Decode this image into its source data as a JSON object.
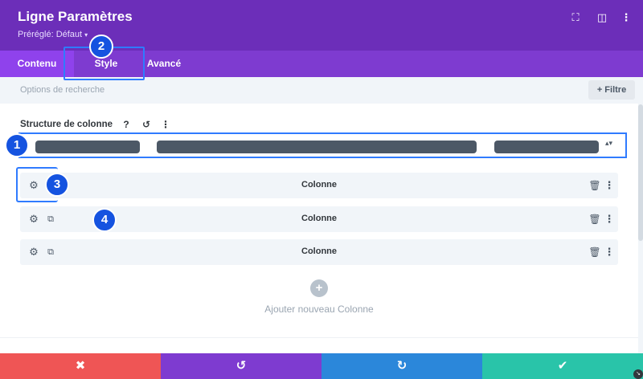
{
  "header": {
    "title": "Ligne Paramètres",
    "preset_label": "Préréglé: Défaut",
    "preset_caret": "▾",
    "icons": {
      "fullscreen": "⛶",
      "split": "◫",
      "more": "⋮"
    }
  },
  "tabs": [
    {
      "label": "Contenu"
    },
    {
      "label": "Style"
    },
    {
      "label": "Avancé"
    }
  ],
  "search": {
    "placeholder": "Options de recherche",
    "filter_label": "+ Filtre"
  },
  "structure": {
    "label": "Structure de colonne",
    "help": "?",
    "reset": "↺",
    "more": "⋮",
    "select_arrow": "▴▾"
  },
  "columns": [
    {
      "label": "Colonne",
      "gear": "⚙",
      "trash": "🗑",
      "more": "⋮"
    },
    {
      "label": "Colonne",
      "gear": "⚙",
      "dup": "⧉",
      "trash": "🗑",
      "more": "⋮"
    },
    {
      "label": "Colonne",
      "gear": "⚙",
      "dup": "⧉",
      "trash": "🗑",
      "more": "⋮"
    }
  ],
  "add": {
    "icon": "+",
    "label": "Ajouter nouveau Colonne"
  },
  "badges": [
    "1",
    "2",
    "3",
    "4"
  ],
  "footer": {
    "cancel": "✖",
    "undo": "↺",
    "redo": "↻",
    "save": "✔"
  },
  "colors": {
    "header": "#6c2eb9",
    "tabs": "#7e3bd0",
    "cancel": "#ef5555",
    "undo": "#7e3bd0",
    "redo": "#2b87da",
    "save": "#29c4a9",
    "annotation": "#1553e0"
  }
}
